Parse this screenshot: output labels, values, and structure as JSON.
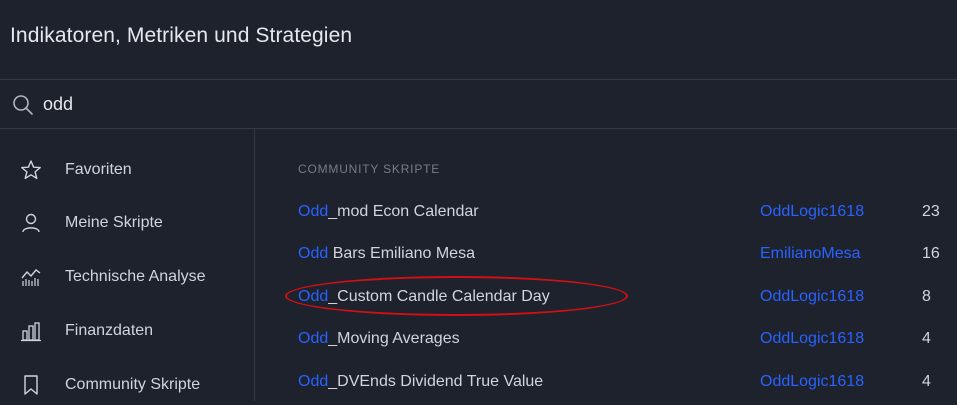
{
  "header": {
    "title": "Indikatoren, Metriken und Strategien"
  },
  "search": {
    "value": "odd",
    "icon": "search-icon"
  },
  "sidebar": {
    "items": [
      {
        "label": "Favoriten",
        "icon": "star-icon"
      },
      {
        "label": "Meine Skripte",
        "icon": "user-icon"
      },
      {
        "label": "Technische Analyse",
        "icon": "chart-line-icon"
      },
      {
        "label": "Finanzdaten",
        "icon": "bar-chart-icon"
      },
      {
        "label": "Community Skripte",
        "icon": "bookmark-icon"
      }
    ]
  },
  "results": {
    "section_title": "COMMUNITY SKRIPTE",
    "rows": [
      {
        "match": "Odd",
        "rest": "_mod Econ Calendar",
        "author": "OddLogic1618",
        "count": "23"
      },
      {
        "match": "Odd",
        "rest": " Bars Emiliano Mesa",
        "author": "EmilianoMesa",
        "count": "16"
      },
      {
        "match": "Odd",
        "rest": "_Custom Candle Calendar Day",
        "author": "OddLogic1618",
        "count": "8"
      },
      {
        "match": "Odd",
        "rest": "_Moving Averages",
        "author": "OddLogic1618",
        "count": "4"
      },
      {
        "match": "Odd",
        "rest": "_DVEnds Dividend True Value",
        "author": "OddLogic1618",
        "count": "4"
      }
    ]
  },
  "colors": {
    "background": "#1e222d",
    "accent": "#2962ff",
    "annotation": "#d40f14",
    "text": "#d1d4dc",
    "muted": "#787b86"
  }
}
